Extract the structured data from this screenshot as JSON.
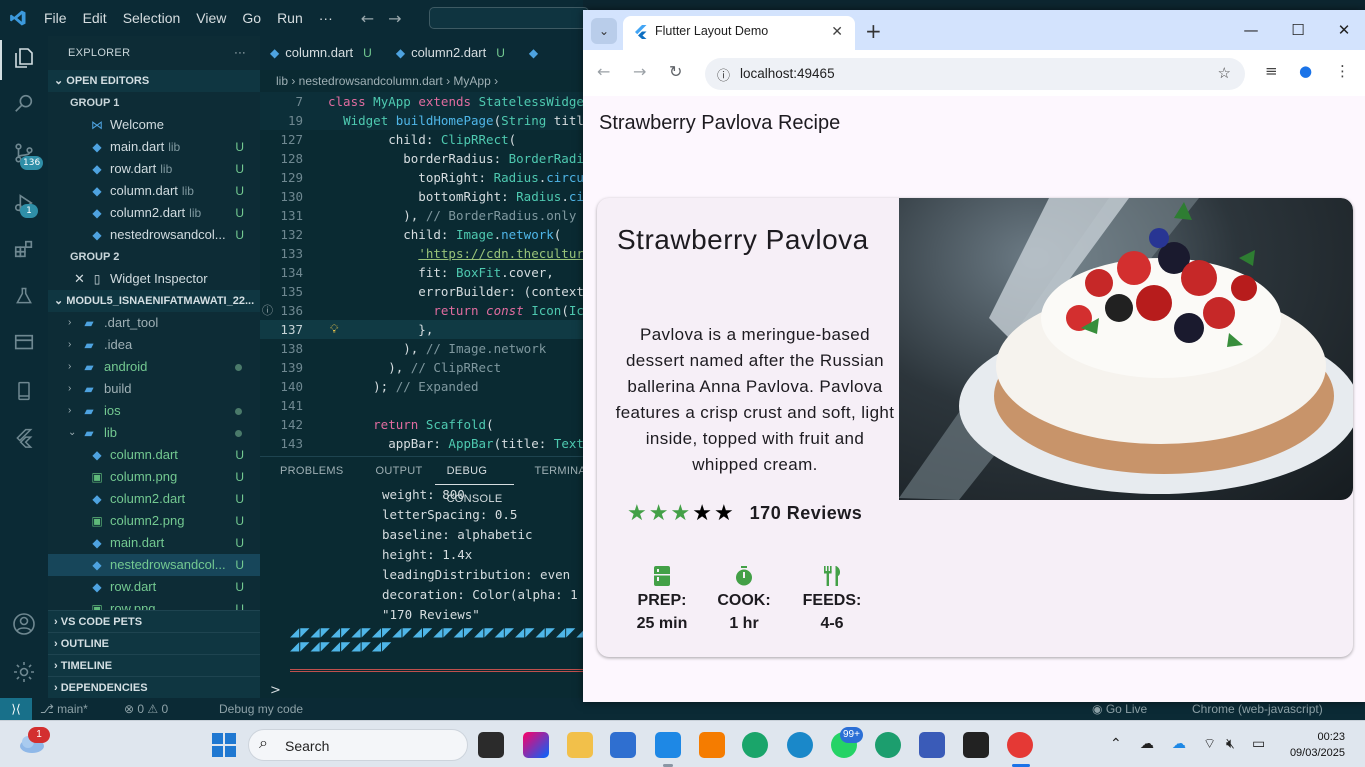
{
  "vscode": {
    "menu": [
      "File",
      "Edit",
      "Selection",
      "View",
      "Go",
      "Run",
      "···"
    ],
    "activity_badges": {
      "scm": "136",
      "debug": "1"
    },
    "explorer": {
      "title": "EXPLORER",
      "more": "···",
      "open_editors": "OPEN EDITORS",
      "group1": "GROUP 1",
      "group1_items": [
        {
          "name": "Welcome",
          "dir": "",
          "status": ""
        },
        {
          "name": "main.dart",
          "dir": "lib",
          "status": "U"
        },
        {
          "name": "row.dart",
          "dir": "lib",
          "status": "U"
        },
        {
          "name": "column.dart",
          "dir": "lib",
          "status": "U"
        },
        {
          "name": "column2.dart",
          "dir": "lib",
          "status": "U"
        },
        {
          "name": "nestedrowsandcol...",
          "dir": "",
          "status": "U"
        }
      ],
      "group2": "GROUP 2",
      "group2_item": "Widget Inspector",
      "project": "MODUL5_ISNAENIFATMAWATI_22...",
      "tree": [
        {
          "name": ".dart_tool",
          "color": "#9fb0b5"
        },
        {
          "name": ".idea",
          "color": "#9fb0b5"
        },
        {
          "name": "android",
          "color": "#73c991"
        },
        {
          "name": "build",
          "color": "#9fb0b5"
        },
        {
          "name": "ios",
          "color": "#73c991"
        },
        {
          "name": "lib",
          "color": "#73c991"
        }
      ],
      "lib_items": [
        {
          "name": "column.dart",
          "status": "U"
        },
        {
          "name": "column.png",
          "status": "U"
        },
        {
          "name": "column2.dart",
          "status": "U"
        },
        {
          "name": "column2.png",
          "status": "U"
        },
        {
          "name": "main.dart",
          "status": "U"
        },
        {
          "name": "nestedrowsandcol...",
          "status": "U"
        },
        {
          "name": "row.dart",
          "status": "U"
        },
        {
          "name": "row.png",
          "status": "U"
        }
      ],
      "bottom_sections": [
        "VS CODE PETS",
        "OUTLINE",
        "TIMELINE",
        "DEPENDENCIES"
      ]
    },
    "tabs": [
      {
        "name": "column.dart",
        "status": "U"
      },
      {
        "name": "column2.dart",
        "status": "U"
      }
    ],
    "breadcrumb": "lib  ›  nestedrowsandcolumn.dart  ›  MyApp  ›",
    "code_lines": [
      {
        "n": "7",
        "html": "<span class='k'>class</span> <span class='ty'>MyApp</span> <span class='k'>extends</span> <span class='ty'>StatelessWidget</span>",
        "sticky": true
      },
      {
        "n": "19",
        "html": "  <span class='ty'>Widget</span> <span class='fn'>buildHomePage</span>(<span class='ty'>String</span> title",
        "sticky": true
      },
      {
        "n": "127",
        "html": "        child: <span class='ty'>ClipRRect</span>("
      },
      {
        "n": "128",
        "html": "          borderRadius: <span class='ty'>BorderRadius</span>."
      },
      {
        "n": "129",
        "html": "            topRight: <span class='ty'>Radius</span>.<span class='fn'>circular</span>"
      },
      {
        "n": "130",
        "html": "            bottomRight: <span class='ty'>Radius</span>.<span class='fn'>cir</span>"
      },
      {
        "n": "131",
        "html": "          ), <span class='cm'>// BorderRadius.only</span>"
      },
      {
        "n": "132",
        "html": "          child: <span class='ty'>Image</span>.<span class='fn'>network</span>("
      },
      {
        "n": "133",
        "html": "            <span class='str'>'https://cdn.theculture</span>"
      },
      {
        "n": "134",
        "html": "            fit: <span class='ty'>BoxFit</span>.cover,"
      },
      {
        "n": "135",
        "html": "            errorBuilder: (context,"
      },
      {
        "n": "136",
        "html": "              <span class='k'>return</span> <span class='k'><i>const</i></span> <span class='ty'>Icon</span>(<span class='ty'>Ico</span>"
      },
      {
        "n": "137",
        "html": "            },",
        "cur": true
      },
      {
        "n": "138",
        "html": "          ), <span class='cm'>// Image.network</span>"
      },
      {
        "n": "139",
        "html": "        ), <span class='cm'>// ClipRRect</span>"
      },
      {
        "n": "140",
        "html": "      ); <span class='cm'>// Expanded</span>"
      },
      {
        "n": "141",
        "html": ""
      },
      {
        "n": "142",
        "html": "      <span class='k'>return</span> <span class='ty'>Scaffold</span>("
      },
      {
        "n": "143",
        "html": "        appBar: <span class='ty'>AppBar</span>(title: <span class='ty'>Text</span>("
      }
    ],
    "panel_tabs": [
      "PROBLEMS",
      "OUTPUT",
      "DEBUG CONSOLE",
      "TERMINAL"
    ],
    "console_lines": [
      "weight: 800",
      "letterSpacing: 0.5",
      "baseline: alphabetic",
      "height: 1.4x",
      "leadingDistribution: even",
      "decoration: Color(alpha: 1",
      "\"170 Reviews\""
    ],
    "console_prompt": ">",
    "status": {
      "branch": "main*",
      "problems": "⊗ 0 ⚠ 0",
      "debug": "Debug my code",
      "golive": "Go Live",
      "target": "Chrome (web-javascript)"
    }
  },
  "chrome": {
    "tab_title": "Flutter Layout Demo",
    "url": "localhost:49465",
    "page": {
      "appbar_title": "Strawberry Pavlova Recipe",
      "title": "Strawberry Pavlova",
      "description": "Pavlova is a meringue-based dessert named after the Russian ballerina Anna Pavlova. Pavlova features a crisp crust and soft, light inside, topped with fruit and whipped cream.",
      "rating": {
        "filled": 3,
        "total": 5
      },
      "reviews": "170 Reviews",
      "stats": [
        {
          "label": "PREP:",
          "value": "25 min",
          "icon": "kitchen-icon"
        },
        {
          "label": "COOK:",
          "value": "1 hr",
          "icon": "timer-icon"
        },
        {
          "label": "FEEDS:",
          "value": "4-6",
          "icon": "restaurant-icon"
        }
      ],
      "colors": {
        "accent": "#43a047"
      }
    }
  },
  "taskbar": {
    "search": "Search",
    "time": "00:23",
    "date": "09/03/2025",
    "weather_badge": "1",
    "whatsapp_badge": "99+"
  }
}
